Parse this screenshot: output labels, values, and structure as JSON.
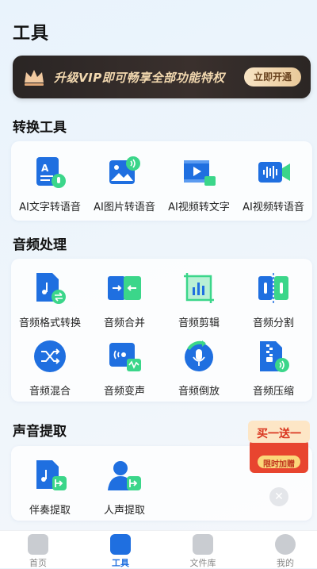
{
  "page_title": "工具",
  "vip_banner": {
    "text": "升级VIP即可畅享全部功能特权",
    "button": "立即开通"
  },
  "sections": [
    {
      "title": "转换工具",
      "tools": [
        "AI文字转语音",
        "AI图片转语音",
        "AI视频转文字",
        "AI视频转语音"
      ]
    },
    {
      "title": "音频处理",
      "tools": [
        "音频格式转换",
        "音频合并",
        "音频剪辑",
        "音频分割",
        "音频混合",
        "音频变声",
        "音频倒放",
        "音频压缩"
      ]
    },
    {
      "title": "声音提取",
      "tools": [
        "伴奏提取",
        "人声提取"
      ]
    }
  ],
  "promo": {
    "top_text": "买一送一",
    "bottom_text": "限时加赠"
  },
  "tabs": [
    {
      "label": "首页",
      "active": false
    },
    {
      "label": "工具",
      "active": true
    },
    {
      "label": "文件库",
      "active": false
    },
    {
      "label": "我的",
      "active": false
    }
  ],
  "colors": {
    "accent": "#1f6fe0",
    "green": "#3bd68a",
    "vip_gold": "#f3d9b0"
  }
}
